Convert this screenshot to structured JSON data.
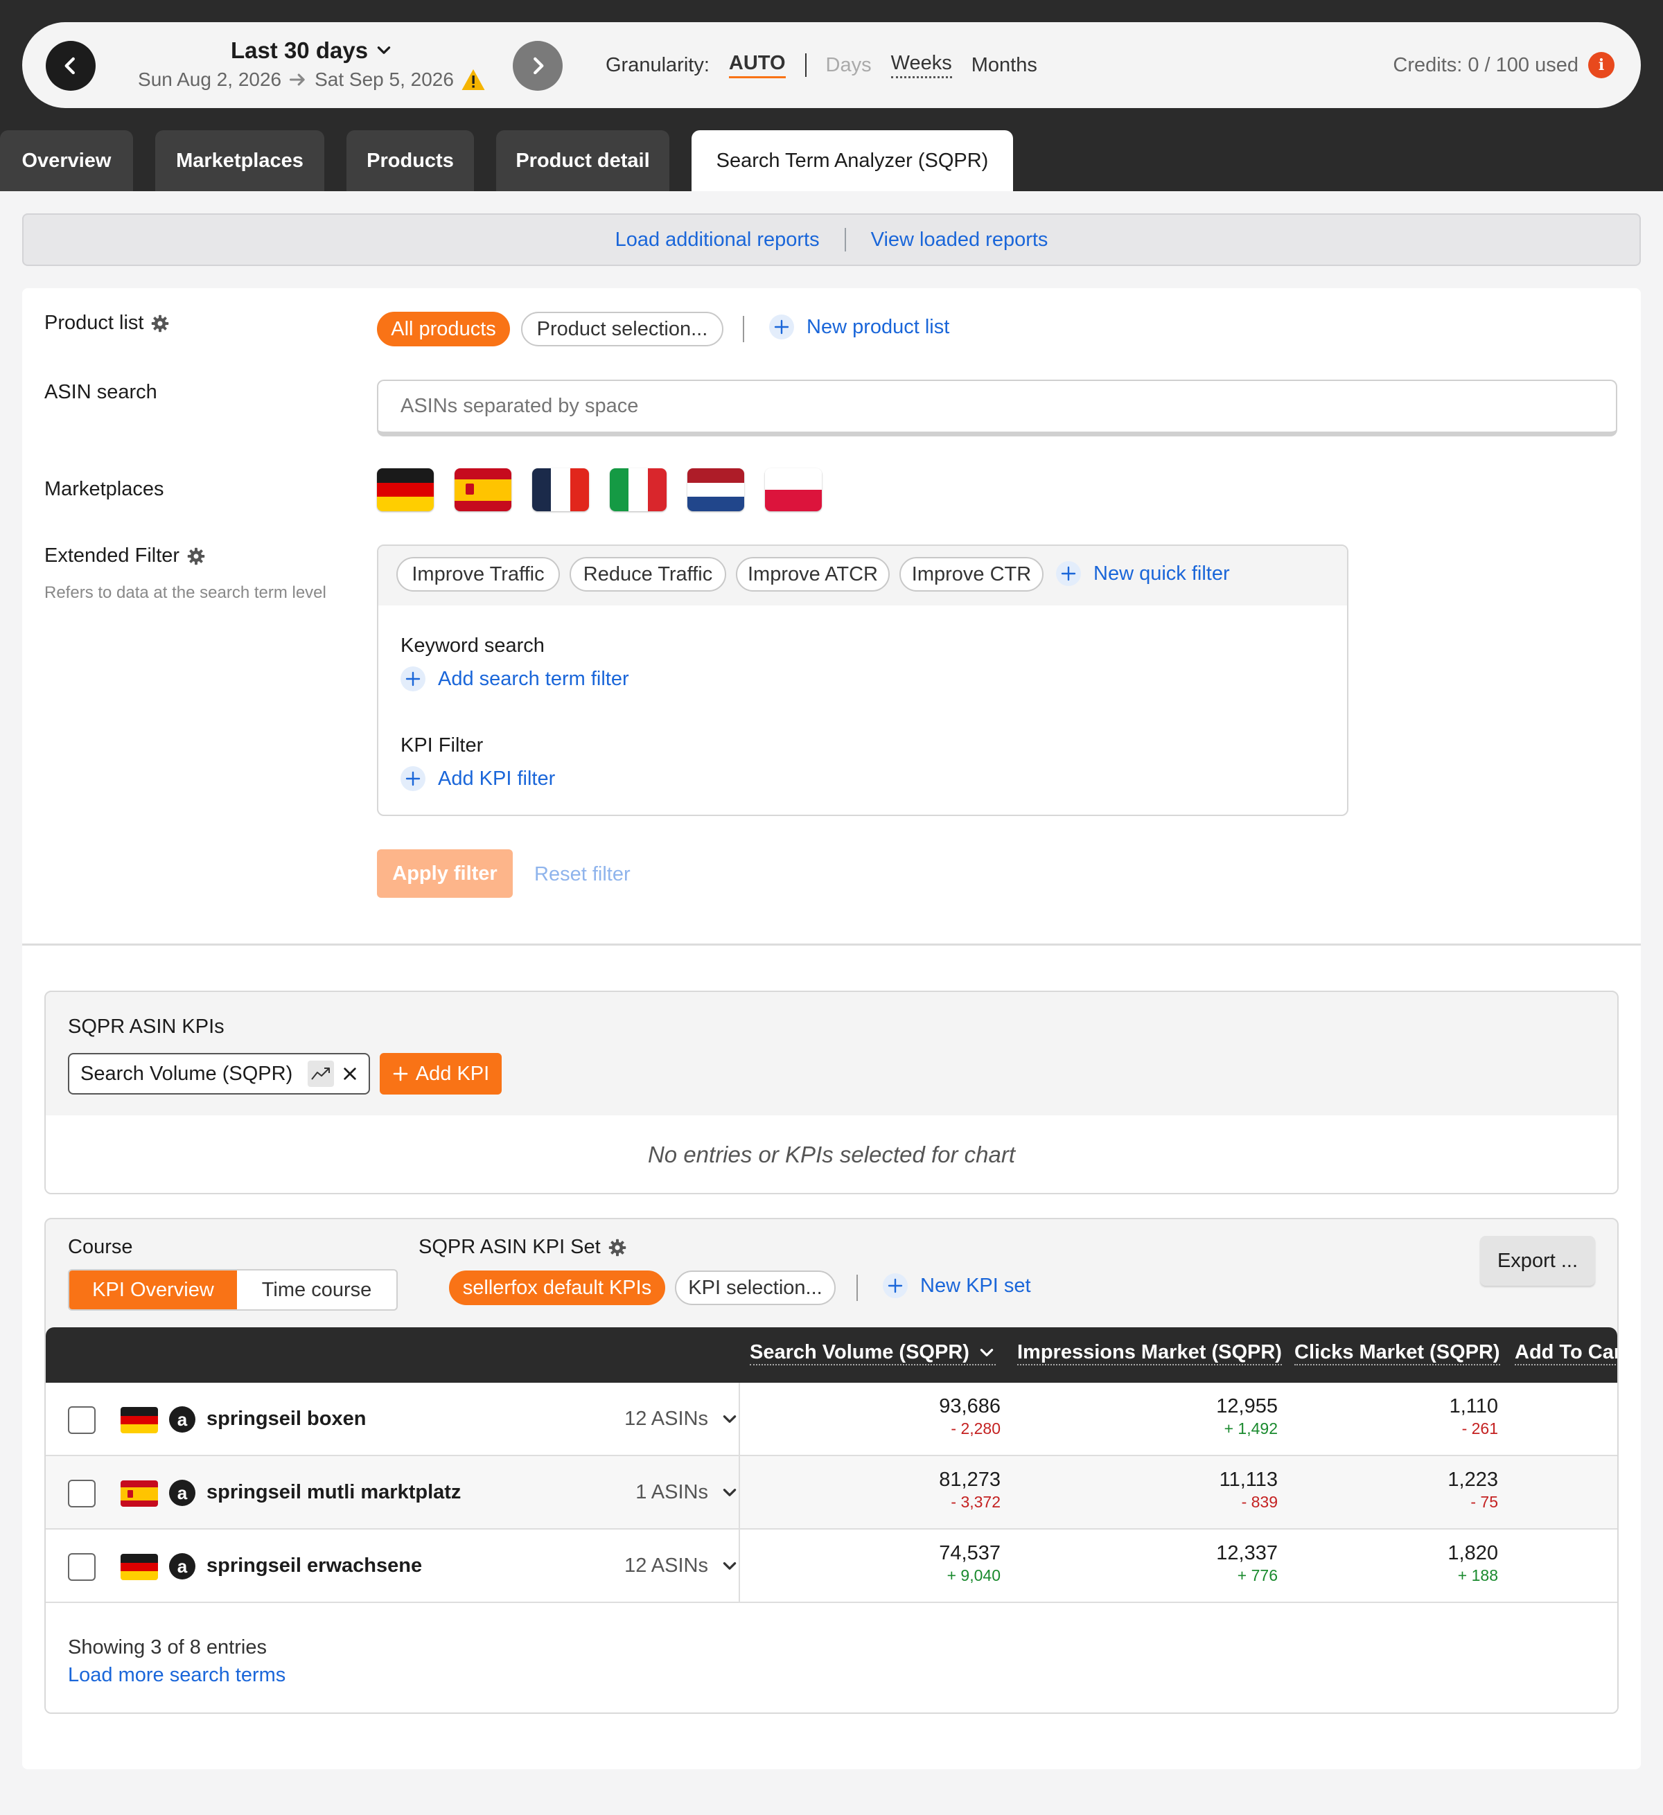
{
  "header": {
    "range_title": "Last 30 days",
    "date_from": "Sun Aug 2, 2026",
    "date_to": "Sat Sep 5, 2026",
    "granularity_label": "Granularity:",
    "granularity_options": [
      "AUTO",
      "Days",
      "Weeks",
      "Months"
    ],
    "credits": "Credits: 0 / 100 used",
    "info_glyph": "i"
  },
  "tabs": [
    "Overview",
    "Marketplaces",
    "Products",
    "Product detail",
    "Search Term Analyzer (SQPR)"
  ],
  "reports": {
    "load": "Load additional reports",
    "view": "View loaded reports"
  },
  "filters": {
    "product_list_label": "Product list",
    "product_chips": [
      "All products",
      "Product selection..."
    ],
    "new_product_list": "New product list",
    "asin_label": "ASIN search",
    "asin_placeholder": "ASINs separated by space",
    "marketplaces_label": "Marketplaces",
    "marketplaces": [
      "DE",
      "ES",
      "FR",
      "IT",
      "NL",
      "PL"
    ],
    "extended_label": "Extended Filter",
    "extended_sub": "Refers to data at the search term level",
    "quick_filters": [
      "Improve Traffic",
      "Reduce Traffic",
      "Improve ATCR",
      "Improve CTR"
    ],
    "new_quick_filter": "New quick filter",
    "keyword_label": "Keyword search",
    "add_search_term": "Add search term filter",
    "kpi_filter_label": "KPI Filter",
    "add_kpi_filter": "Add KPI filter",
    "apply": "Apply filter",
    "reset": "Reset filter"
  },
  "chart_card": {
    "title": "SQPR ASIN KPIs",
    "kpi_chip": "Search Volume (SQPR)",
    "add_kpi": "Add KPI",
    "empty": "No entries or KPIs selected for chart"
  },
  "table_card": {
    "course_label": "Course",
    "course_options": [
      "KPI Overview",
      "Time course"
    ],
    "kpi_set_label": "SQPR ASIN KPI Set",
    "kpi_set_chips": [
      "sellerfox default KPIs",
      "KPI selection..."
    ],
    "new_kpi_set": "New KPI set",
    "export": "Export ...",
    "columns": [
      "Search Volume (SQPR)",
      "Impressions Market (SQPR)",
      "Clicks Market (SQPR)",
      "Add To Car"
    ],
    "rows": [
      {
        "flag": "de",
        "term": "springseil boxen",
        "asins": "12 ASINs",
        "values": [
          {
            "v": "93,686",
            "d": "- 2,280",
            "t": "neg"
          },
          {
            "v": "12,955",
            "d": "+ 1,492",
            "t": "pos"
          },
          {
            "v": "1,110",
            "d": "- 261",
            "t": "neg"
          }
        ]
      },
      {
        "flag": "es",
        "term": "springseil mutli marktplatz",
        "asins": "1 ASINs",
        "values": [
          {
            "v": "81,273",
            "d": "- 3,372",
            "t": "neg"
          },
          {
            "v": "11,113",
            "d": "- 839",
            "t": "neg"
          },
          {
            "v": "1,223",
            "d": "- 75",
            "t": "neg"
          }
        ]
      },
      {
        "flag": "de",
        "term": "springseil erwachsene",
        "asins": "12 ASINs",
        "values": [
          {
            "v": "74,537",
            "d": "+ 9,040",
            "t": "pos"
          },
          {
            "v": "12,337",
            "d": "+ 776",
            "t": "pos"
          },
          {
            "v": "1,820",
            "d": "+ 188",
            "t": "pos"
          }
        ]
      }
    ],
    "amazon_glyph": "a",
    "showing": "Showing 3 of 8 entries",
    "load_more": "Load more search terms"
  },
  "colors": {
    "accent": "#f97316",
    "link": "#1a66d9",
    "negative": "#c42121",
    "positive": "#1a8a2e",
    "dark": "#2b2b2b"
  }
}
